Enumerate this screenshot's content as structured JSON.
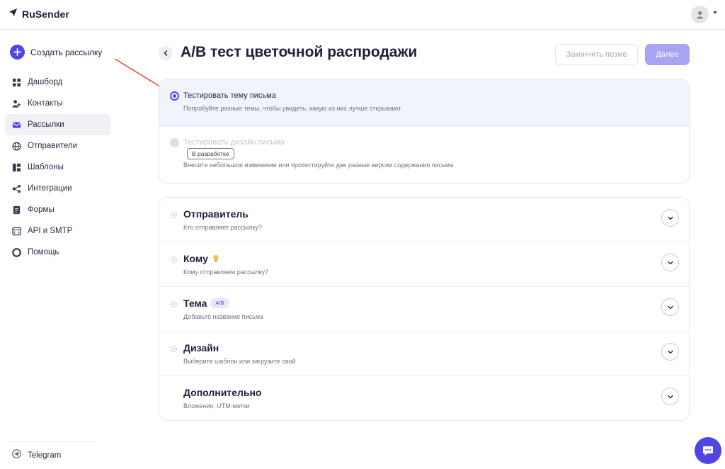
{
  "app": {
    "name": "RuSender"
  },
  "sidebar": {
    "create_label": "Создать рассылку",
    "items": [
      {
        "label": "Дашборд",
        "icon": "dashboard-icon",
        "active": false
      },
      {
        "label": "Контакты",
        "icon": "contacts-icon",
        "active": false
      },
      {
        "label": "Рассылки",
        "icon": "mailings-icon",
        "active": true
      },
      {
        "label": "Отправители",
        "icon": "senders-globe-icon",
        "active": false
      },
      {
        "label": "Шаблоны",
        "icon": "templates-icon",
        "active": false
      },
      {
        "label": "Интеграции",
        "icon": "integrations-icon",
        "active": false
      },
      {
        "label": "Формы",
        "icon": "forms-icon",
        "active": false
      },
      {
        "label": "API и SMTP",
        "icon": "api-icon",
        "active": false
      },
      {
        "label": "Помощь",
        "icon": "help-icon",
        "active": false
      }
    ],
    "telegram_label": "Telegram"
  },
  "header": {
    "title": "A/B тест цветочной распродажи",
    "later_label": "Закончить позже",
    "next_label": "Далее"
  },
  "test_options": [
    {
      "title": "Тестировать тему письма",
      "description": "Попробуйте разные темы, чтобы увидеть, какую из них лучше открывают",
      "selected": true,
      "enabled": true
    },
    {
      "title": "Тестировать дизайн письма",
      "badge": "В разработке",
      "description": "Внесите небольшое изменение или протестируйте две разные версии содержания письма",
      "selected": false,
      "enabled": false
    }
  ],
  "steps": [
    {
      "title": "Отправитель",
      "subtitle": "Кто отправляет рассылку?"
    },
    {
      "title": "Кому",
      "subtitle": "Кому отправляем рассылку?"
    },
    {
      "title": "Тема",
      "badge": "A/B",
      "subtitle": "Добавьте название письма"
    },
    {
      "title": "Дизайн",
      "subtitle": "Выберите шаблон или загрузите свой"
    },
    {
      "title": "Дополнительно",
      "subtitle": "Вложения, UTM-метки"
    }
  ],
  "colors": {
    "accent": "#4f46e5",
    "accent_disabled": "#a8a4f2",
    "selected_bg": "#f1f4fd",
    "annotation_arrow": "#e8472b"
  }
}
